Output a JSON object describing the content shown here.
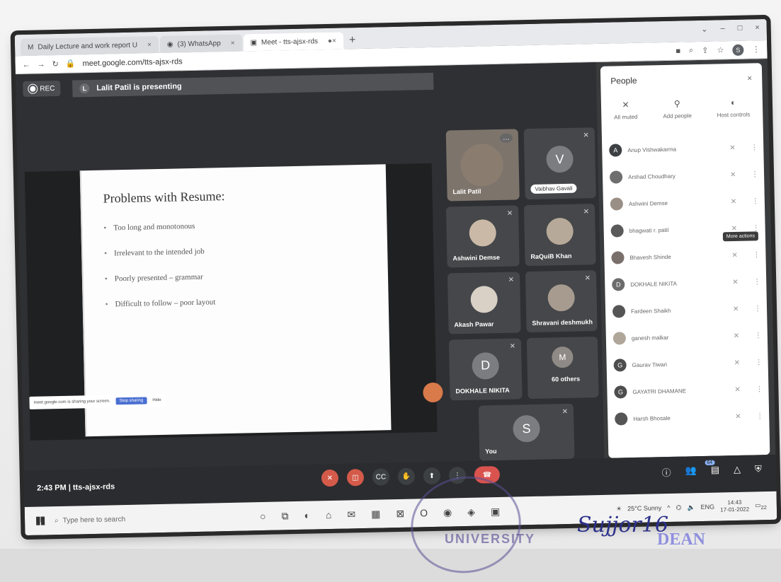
{
  "browser": {
    "tabs": [
      {
        "label": "Daily Lecture and work report U"
      },
      {
        "label": "(3) WhatsApp"
      },
      {
        "label": "Meet - tts-ajsx-rds"
      }
    ],
    "url": "meet.google.com/tts-ajsx-rds",
    "profile_initial": "S"
  },
  "meet": {
    "rec_label": "REC",
    "presenter_initial": "L",
    "presenting_text": "Lalit Patil is presenting",
    "slide": {
      "title": "Problems with Resume:",
      "bullets": [
        "Too long and monotonous",
        "Irrelevant to the intended job",
        "Poorly presented – grammar",
        "Difficult to follow – poor layout"
      ]
    },
    "share_notice_text": "meet.google.com is sharing your screen.",
    "stop_sharing_label": "Stop sharing",
    "hide_label": "Hide",
    "tiles": {
      "lalit": "Lalit Patil",
      "vaibhav": {
        "initial": "V",
        "name": "Vaibhav Gavali"
      },
      "ashwini": "Ashwini Demse",
      "raquib": "RaQuiB Khan",
      "akash": "Akash Pawar",
      "shravani": "Shravani deshmukh",
      "dokhale": {
        "initial": "D",
        "name": "DOKHALE NIKITA"
      },
      "others": {
        "initial": "M",
        "label": "60 others"
      },
      "you": {
        "initial": "S",
        "name": "You"
      }
    },
    "bottom": {
      "time": "2:43 PM",
      "meeting_code": "tts-ajsx-rds",
      "people_count": "64"
    }
  },
  "people_panel": {
    "title": "People",
    "actions": {
      "all_muted": "All muted",
      "add_people": "Add people",
      "host_controls": "Host controls"
    },
    "participants": [
      {
        "initial": "A",
        "name": "Anup Vishwakarma",
        "color": "#3c4043"
      },
      {
        "initial": "",
        "name": "Arshad Choudhary",
        "color": "#6e6e6e"
      },
      {
        "initial": "",
        "name": "Ashwini Demse",
        "color": "#9a8f86"
      },
      {
        "initial": "",
        "name": "bhagwati r. patil",
        "color": "#5a5a5a"
      },
      {
        "initial": "",
        "name": "Bhavesh Shinde",
        "color": "#7a6f6a"
      },
      {
        "initial": "D",
        "name": "DOKHALE NIKITA",
        "color": "#6c6c6c"
      },
      {
        "initial": "",
        "name": "Fardeen Shaikh",
        "color": "#555555"
      },
      {
        "initial": "",
        "name": "ganesh malkar",
        "color": "#b0a69a"
      },
      {
        "initial": "G",
        "name": "Gaurav Tiwari",
        "color": "#4d4d4d"
      },
      {
        "initial": "G",
        "name": "GAYATRI DHAMANE",
        "color": "#4d4d4d"
      },
      {
        "initial": "",
        "name": "Harsh Bhosale",
        "color": "#555555"
      }
    ],
    "tooltip": "More actions"
  },
  "taskbar": {
    "search_placeholder": "Type here to search",
    "weather": "25°C Sunny",
    "lang": "ENG",
    "time": "14:43",
    "date": "17-01-2022",
    "notif_count": "22"
  },
  "overlay": {
    "stamp_text": "UNIVERSITY",
    "signature": "Sujjor16",
    "dean": "DEAN"
  }
}
